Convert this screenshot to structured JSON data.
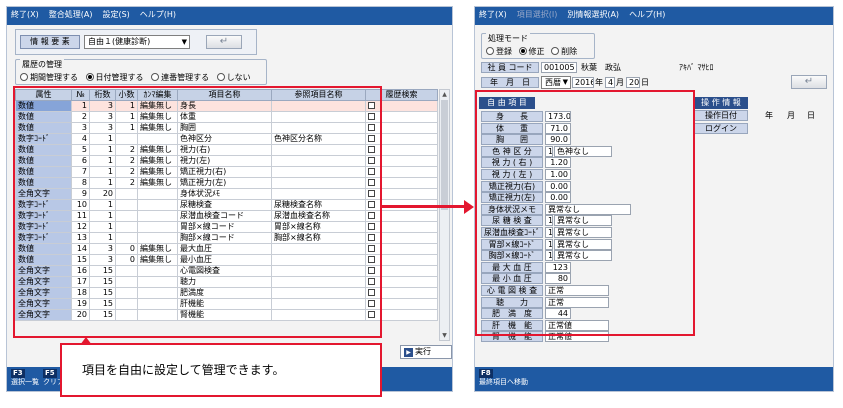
{
  "left": {
    "menu": [
      "終了(X)",
      "整合処理(A)",
      "設定(S)",
      "ヘルプ(H)"
    ],
    "info_label": "情 報 要 素",
    "info_select": "自由１(健康診断)",
    "history": {
      "title": "履歴の管理",
      "options": [
        "期間管理する",
        "日付管理する",
        "連番管理する",
        "しない"
      ],
      "selected_index": 1
    },
    "table": {
      "headers": [
        "属性",
        "№",
        "桁数",
        "小数",
        "ｶﾝﾏ編集",
        "項目名称",
        "参照項目名称",
        "履歴検索"
      ],
      "rows": [
        [
          "数値",
          "1",
          "3",
          "1",
          "編集無し",
          "身長",
          ""
        ],
        [
          "数値",
          "2",
          "3",
          "1",
          "編集無し",
          "体重",
          ""
        ],
        [
          "数値",
          "3",
          "3",
          "1",
          "編集無し",
          "胸囲",
          ""
        ],
        [
          "数字ｺｰﾄﾞ",
          "4",
          "1",
          "",
          "",
          "色神区分",
          "色神区分名称"
        ],
        [
          "数値",
          "5",
          "1",
          "2",
          "編集無し",
          "視力(右)",
          ""
        ],
        [
          "数値",
          "6",
          "1",
          "2",
          "編集無し",
          "視力(左)",
          ""
        ],
        [
          "数値",
          "7",
          "1",
          "2",
          "編集無し",
          "矯正視力(右)",
          ""
        ],
        [
          "数値",
          "8",
          "1",
          "2",
          "編集無し",
          "矯正視力(左)",
          ""
        ],
        [
          "全角文字",
          "9",
          "20",
          "",
          "",
          "身体状況ﾒﾓ",
          ""
        ],
        [
          "数字ｺｰﾄﾞ",
          "10",
          "1",
          "",
          "",
          "尿糖検査",
          "尿糖検査名称"
        ],
        [
          "数字ｺｰﾄﾞ",
          "11",
          "1",
          "",
          "",
          "尿潜血検査コード",
          "尿潜血検査名称"
        ],
        [
          "数字ｺｰﾄﾞ",
          "12",
          "1",
          "",
          "",
          "胃部×線コード",
          "胃部×線名称"
        ],
        [
          "数字ｺｰﾄﾞ",
          "13",
          "1",
          "",
          "",
          "胸部×線コード",
          "胸部×線名称"
        ],
        [
          "数値",
          "14",
          "3",
          "0",
          "編集無し",
          "最大血圧",
          ""
        ],
        [
          "数値",
          "15",
          "3",
          "0",
          "編集無し",
          "最小血圧",
          ""
        ],
        [
          "全角文字",
          "16",
          "15",
          "",
          "",
          "心電図検査",
          ""
        ],
        [
          "全角文字",
          "17",
          "15",
          "",
          "",
          "聴力",
          ""
        ],
        [
          "全角文字",
          "18",
          "15",
          "",
          "",
          "肥満度",
          ""
        ],
        [
          "全角文字",
          "19",
          "15",
          "",
          "",
          "肝機能",
          ""
        ],
        [
          "全角文字",
          "20",
          "15",
          "",
          "",
          "腎機能",
          ""
        ]
      ],
      "selected_row": 0
    },
    "run_button": "実行",
    "fkeys": [
      {
        "key": "F3",
        "label": "選択一覧"
      },
      {
        "key": "F5",
        "label": "クリア"
      }
    ],
    "callout": "項目を自由に設定して管理できます。"
  },
  "right": {
    "menu": [
      "終了(X)",
      "項目選択(I)",
      "別情報選択(A)",
      "ヘルプ(H)"
    ],
    "mode": {
      "title": "処理モード",
      "options": [
        "登録",
        "修正",
        "削除"
      ],
      "selected_index": 1
    },
    "employee": {
      "label": "社 員 コード",
      "code": "001005",
      "name": "秋葉　政弘",
      "kana": "ｱｷﾊﾞ ﾏｻﾋﾛ"
    },
    "date": {
      "label": "年　月　日",
      "era": "西暦",
      "year": "2016",
      "y_unit": "年",
      "month": "4",
      "m_unit": "月",
      "day": "20",
      "d_unit": "日"
    },
    "free_header": "自 由 項 目",
    "free_items": [
      {
        "label": "身　　長",
        "value": "173.0",
        "extra": ""
      },
      {
        "label": "体　　重",
        "value": "71.0",
        "extra": ""
      },
      {
        "label": "胸　　囲",
        "value": "90.0",
        "extra": ""
      },
      {
        "label": "色 神 区 分",
        "value": "1",
        "extra": "色神なし"
      },
      {
        "label": "視 力 ( 右 )",
        "value": "1.20",
        "extra": ""
      },
      {
        "label": "視 力 ( 左 )",
        "value": "1.00",
        "extra": ""
      },
      {
        "label": "矯正視力(右)",
        "value": "0.00",
        "extra": ""
      },
      {
        "label": "矯正視力(左)",
        "value": "0.00",
        "extra": ""
      },
      {
        "label": "身体状況メモ",
        "value": "異常なし",
        "extra": ""
      },
      {
        "label": "尿 糖 検 査",
        "value": "1",
        "extra": "異常なし"
      },
      {
        "label": "尿潜血検査ｺｰﾄﾞ",
        "value": "1",
        "extra": "異常なし"
      },
      {
        "label": "胃部×線ｺｰﾄﾞ",
        "value": "1",
        "extra": "異常なし"
      },
      {
        "label": "胸部×線ｺｰﾄﾞ",
        "value": "1",
        "extra": "異常なし"
      },
      {
        "label": "最 大 血 圧",
        "value": "123",
        "extra": ""
      },
      {
        "label": "最 小 血 圧",
        "value": "80",
        "extra": ""
      },
      {
        "label": "心 電 図 検 査",
        "value": "正常",
        "extra": ""
      },
      {
        "label": "聴　　力",
        "value": "正常",
        "extra": ""
      },
      {
        "label": "肥　満　度",
        "value": "44",
        "extra": ""
      },
      {
        "label": "肝　機　能",
        "value": "正常値",
        "extra": ""
      },
      {
        "label": "腎　機　能",
        "value": "正常値",
        "extra": ""
      }
    ],
    "op_header": "操 作 情 報",
    "op_date_label": "操作日付",
    "op_date_units": [
      "年",
      "月",
      "日"
    ],
    "op_login_label": "ログイン",
    "fkey": {
      "key": "F8",
      "label": "最終項目へ移動"
    }
  }
}
